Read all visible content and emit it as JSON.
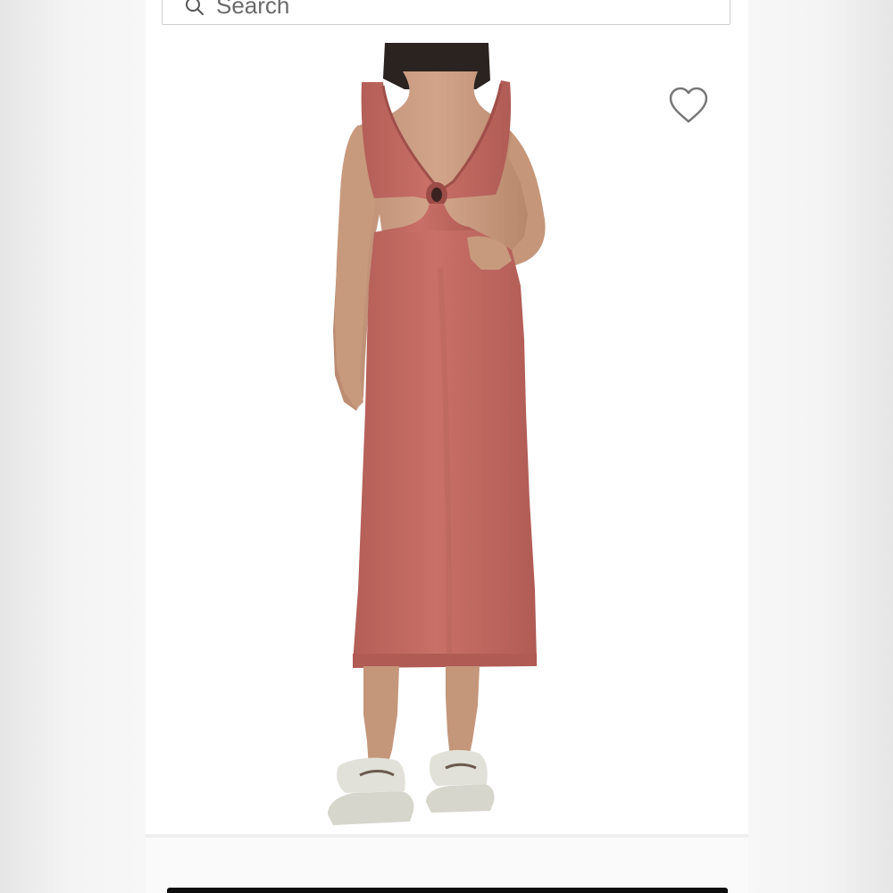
{
  "search": {
    "placeholder": "Search",
    "icon": "search-icon"
  },
  "product": {
    "image_subject": "dress-photo",
    "dress_color": "#c26a62",
    "sandal_color": "#dddcd3",
    "favorite_icon": "heart-outline-icon"
  },
  "colors": {
    "page_background": "#f5f5f5",
    "panel_background": "#ffffff",
    "border": "#cfcfcf",
    "cta": "#0d0d0d"
  }
}
